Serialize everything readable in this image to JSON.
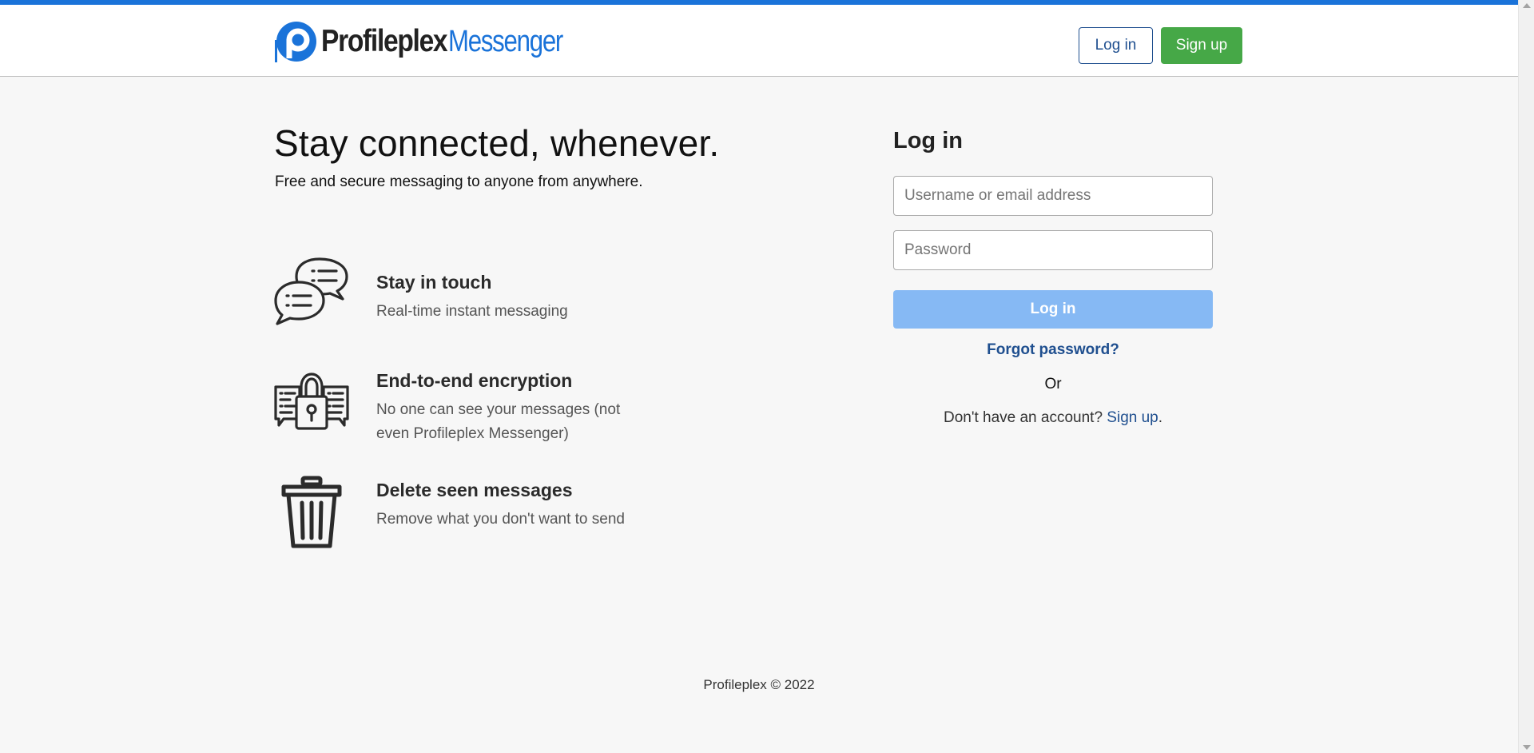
{
  "brand": {
    "name_part1": "Profileplex",
    "name_part2": "Messenger",
    "accent_color": "#1a73d9",
    "logo_icon": "profileplex-p-logo-icon"
  },
  "header": {
    "login_label": "Log in",
    "signup_label": "Sign up"
  },
  "hero": {
    "title": "Stay connected, whenever.",
    "subtitle": "Free and secure messaging to anyone from anywhere."
  },
  "features": [
    {
      "icon": "chat-bubbles-icon",
      "title": "Stay in touch",
      "description": "Real-time instant messaging"
    },
    {
      "icon": "encryption-lock-icon",
      "title": "End-to-end encryption",
      "description": "No one can see your messages (not even Profileplex Messenger)"
    },
    {
      "icon": "trash-can-icon",
      "title": "Delete seen messages",
      "description": "Remove what you don't want to send"
    }
  ],
  "login_form": {
    "title": "Log in",
    "username_placeholder": "Username or email address",
    "username_value": "",
    "password_placeholder": "Password",
    "password_value": "",
    "submit_label": "Log in",
    "forgot_label": "Forgot password?",
    "or_label": "Or",
    "no_account_text": "Don't have an account? ",
    "signup_link_label": "Sign up",
    "signup_suffix": "."
  },
  "footer": {
    "text": "Profileplex © 2022"
  },
  "colors": {
    "primary_blue": "#1f4f8f",
    "signup_green": "#46a847",
    "disabled_button": "#86b9f4",
    "background": "#f7f7f7"
  }
}
